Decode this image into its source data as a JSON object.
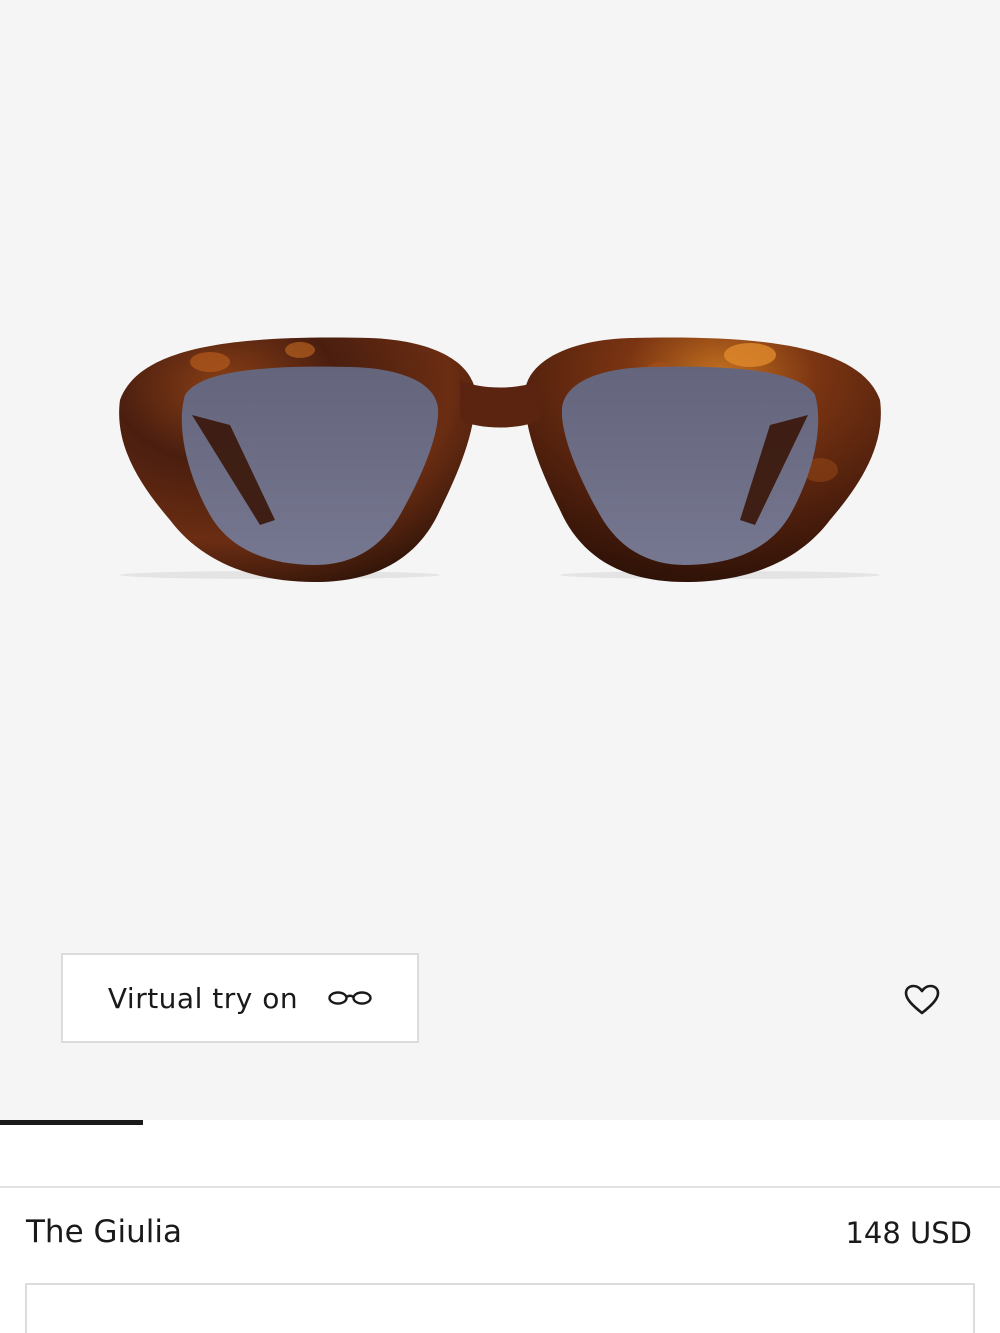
{
  "gallery": {
    "image_alt": "The Giulia sunglasses in tortoise",
    "active_slide": 1
  },
  "try_on": {
    "label": "Virtual try on",
    "icon": "glasses-icon"
  },
  "favorite": {
    "icon": "heart-icon"
  },
  "product": {
    "name": "The Giulia",
    "price": "148 USD"
  },
  "colors": {
    "frame_dark": "#3a1a0f",
    "frame_light": "#b5651d",
    "lens": "#6e6f85",
    "hero_background": "#f5f5f5"
  }
}
